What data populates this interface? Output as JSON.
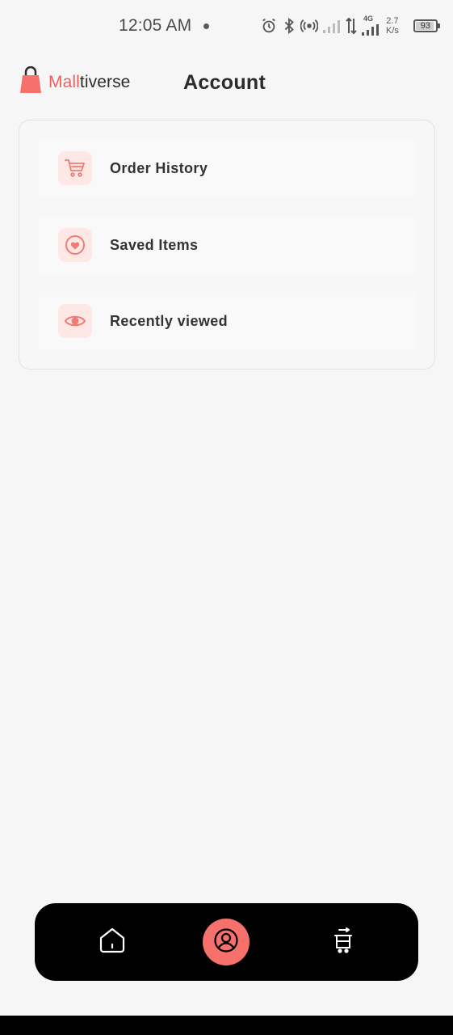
{
  "status_bar": {
    "time": "12:05 AM",
    "network_type": "4G",
    "net_speed_value": "2.7",
    "net_speed_unit": "K/s",
    "battery": "93",
    "battery_level": 0.93,
    "icons": [
      "alarm-icon",
      "bluetooth-icon",
      "hotspot-icon",
      "signal-icon",
      "data-arrows-icon",
      "signal-4g-icon",
      "battery-icon"
    ]
  },
  "header": {
    "brand_part1": "Mall",
    "brand_part2": "tiverse",
    "title": "Account"
  },
  "menu": {
    "items": [
      {
        "label": "Order History",
        "icon": "cart-icon"
      },
      {
        "label": "Saved Items",
        "icon": "heart-icon"
      },
      {
        "label": "Recently viewed",
        "icon": "eye-icon"
      }
    ]
  },
  "bottom_nav": {
    "items": [
      {
        "icon": "home-icon",
        "active": false
      },
      {
        "icon": "user-icon",
        "active": true
      },
      {
        "icon": "cart-transfer-icon",
        "active": false
      }
    ]
  },
  "colors": {
    "accent": "#f6716b",
    "brand_red": "#f0605a",
    "icon_bg": "#fde8e6",
    "nav_bg": "#000000",
    "page_bg": "#f6f6f6"
  }
}
